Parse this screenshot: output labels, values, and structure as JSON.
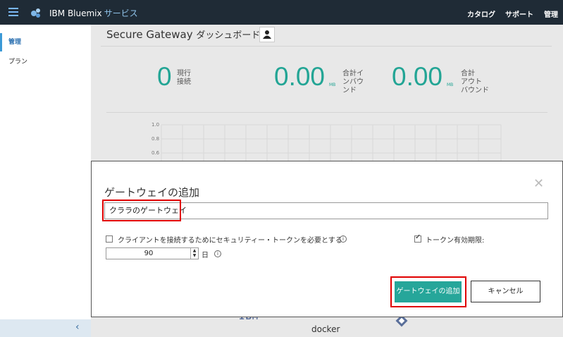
{
  "header": {
    "brand": "IBM Bluemix",
    "service": "サービス",
    "nav": [
      "カタログ",
      "サポート",
      "管理"
    ]
  },
  "sidebar": {
    "items": [
      {
        "label": "管理",
        "active": true
      },
      {
        "label": "プラン",
        "active": false
      }
    ],
    "collapse_icon": "chevron-left-icon"
  },
  "dashboard": {
    "title": "Secure Gateway",
    "title_jp": "ダッシュボード",
    "metrics": [
      {
        "value": "0",
        "unit": "",
        "label_lines": [
          "現行",
          "接続"
        ]
      },
      {
        "value": "0.00",
        "unit": "MB",
        "label_lines": [
          "合計イ",
          "ンバウ",
          "ンド"
        ]
      },
      {
        "value": "0.00",
        "unit": "MB",
        "label_lines": [
          "合計",
          "アウト",
          "バウンド"
        ]
      }
    ],
    "chart_yticks": [
      "1.0",
      "0.8",
      "0.6"
    ],
    "footer_logos": [
      "IBM",
      "docker"
    ]
  },
  "modal": {
    "title": "ゲートウェイの追加",
    "name_value": "クララのゲートウェイ",
    "require_token_label": "クライアントを接続するためにセキュリティー・トークンを必要とする",
    "require_token_checked": false,
    "token_expiry_label": "トークン有効期限:",
    "token_expiry_checked": true,
    "expiry_value": "90",
    "expiry_unit": "日",
    "add_button": "ゲートウェイの追加",
    "cancel_button": "キャンセル",
    "accent_color": "#26a69a",
    "highlight_color": "#e00000"
  }
}
